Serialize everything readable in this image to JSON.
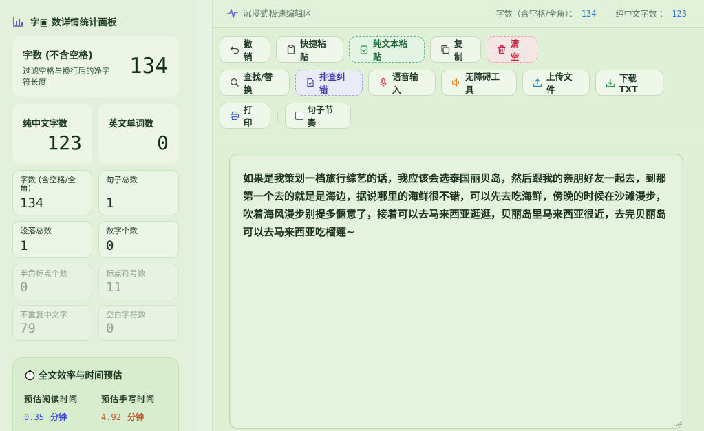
{
  "sidebar": {
    "title": "字▣ 数详情统计面板",
    "main_stat": {
      "label": "字数 (不含空格)",
      "desc": "过滤空格与换行后的净字符长度",
      "value": "134"
    },
    "mid_stats": [
      {
        "label": "纯中文字数",
        "value": "123"
      },
      {
        "label": "英文单词数",
        "value": "0"
      }
    ],
    "small_stats": [
      {
        "label": "字数 (含空格/全角)",
        "value": "134"
      },
      {
        "label": "句子总数",
        "value": "1"
      },
      {
        "label": "段落总数",
        "value": "1"
      },
      {
        "label": "数字个数",
        "value": "0"
      },
      {
        "label": "半角标点个数",
        "value": "0"
      },
      {
        "label": "标点符号数",
        "value": "11"
      },
      {
        "label": "不重复中文字",
        "value": "79"
      },
      {
        "label": "空白字符数",
        "value": "0"
      }
    ],
    "efficiency": {
      "title": "全文效率与时间预估",
      "read_label": "预估阅读时间",
      "write_label": "预估手写时间",
      "read_value": "0.35",
      "write_value": "4.92",
      "unit": "分钟"
    }
  },
  "editor": {
    "title": "沉浸式极速编辑区",
    "stats": {
      "total_label": "字数（含空格/全角）：",
      "total_value": "134",
      "chinese_label": "纯中文字数 ：",
      "chinese_value": "123",
      "separator": "|"
    },
    "toolbar": {
      "undo": "撤销",
      "quick_paste": "快捷粘贴",
      "plain_paste": "纯文本粘贴",
      "copy": "复制",
      "clear": "清空",
      "find_replace": "查找/替换",
      "proofread": "排查纠错",
      "voice_input": "语音输入",
      "accessibility": "无障碍工具",
      "upload": "上传文件",
      "download": "下载TXT",
      "print": "打印",
      "rhythm": "句子节奏"
    },
    "content": "如果是我策划一档旅行综艺的话，我应该会选泰国丽贝岛，然后跟我的亲朋好友一起去，到那第一个去的就是是海边，据说哪里的海鲜很不错，可以先去吃海鲜，傍晚的时候在沙滩漫步，吹着海风漫步别提多惬意了，接着可以去马来西亚逛逛，贝丽岛里马来西亚很近，去完贝丽岛可以去马来西亚吃榴莲~"
  },
  "colors": {
    "accent_green": "#5eb884",
    "danger": "#c6233d",
    "purple": "#3f3aa5",
    "read_time": "#3a4fd1",
    "write_time": "#c2552a",
    "stat_number": "#2f78c4"
  }
}
